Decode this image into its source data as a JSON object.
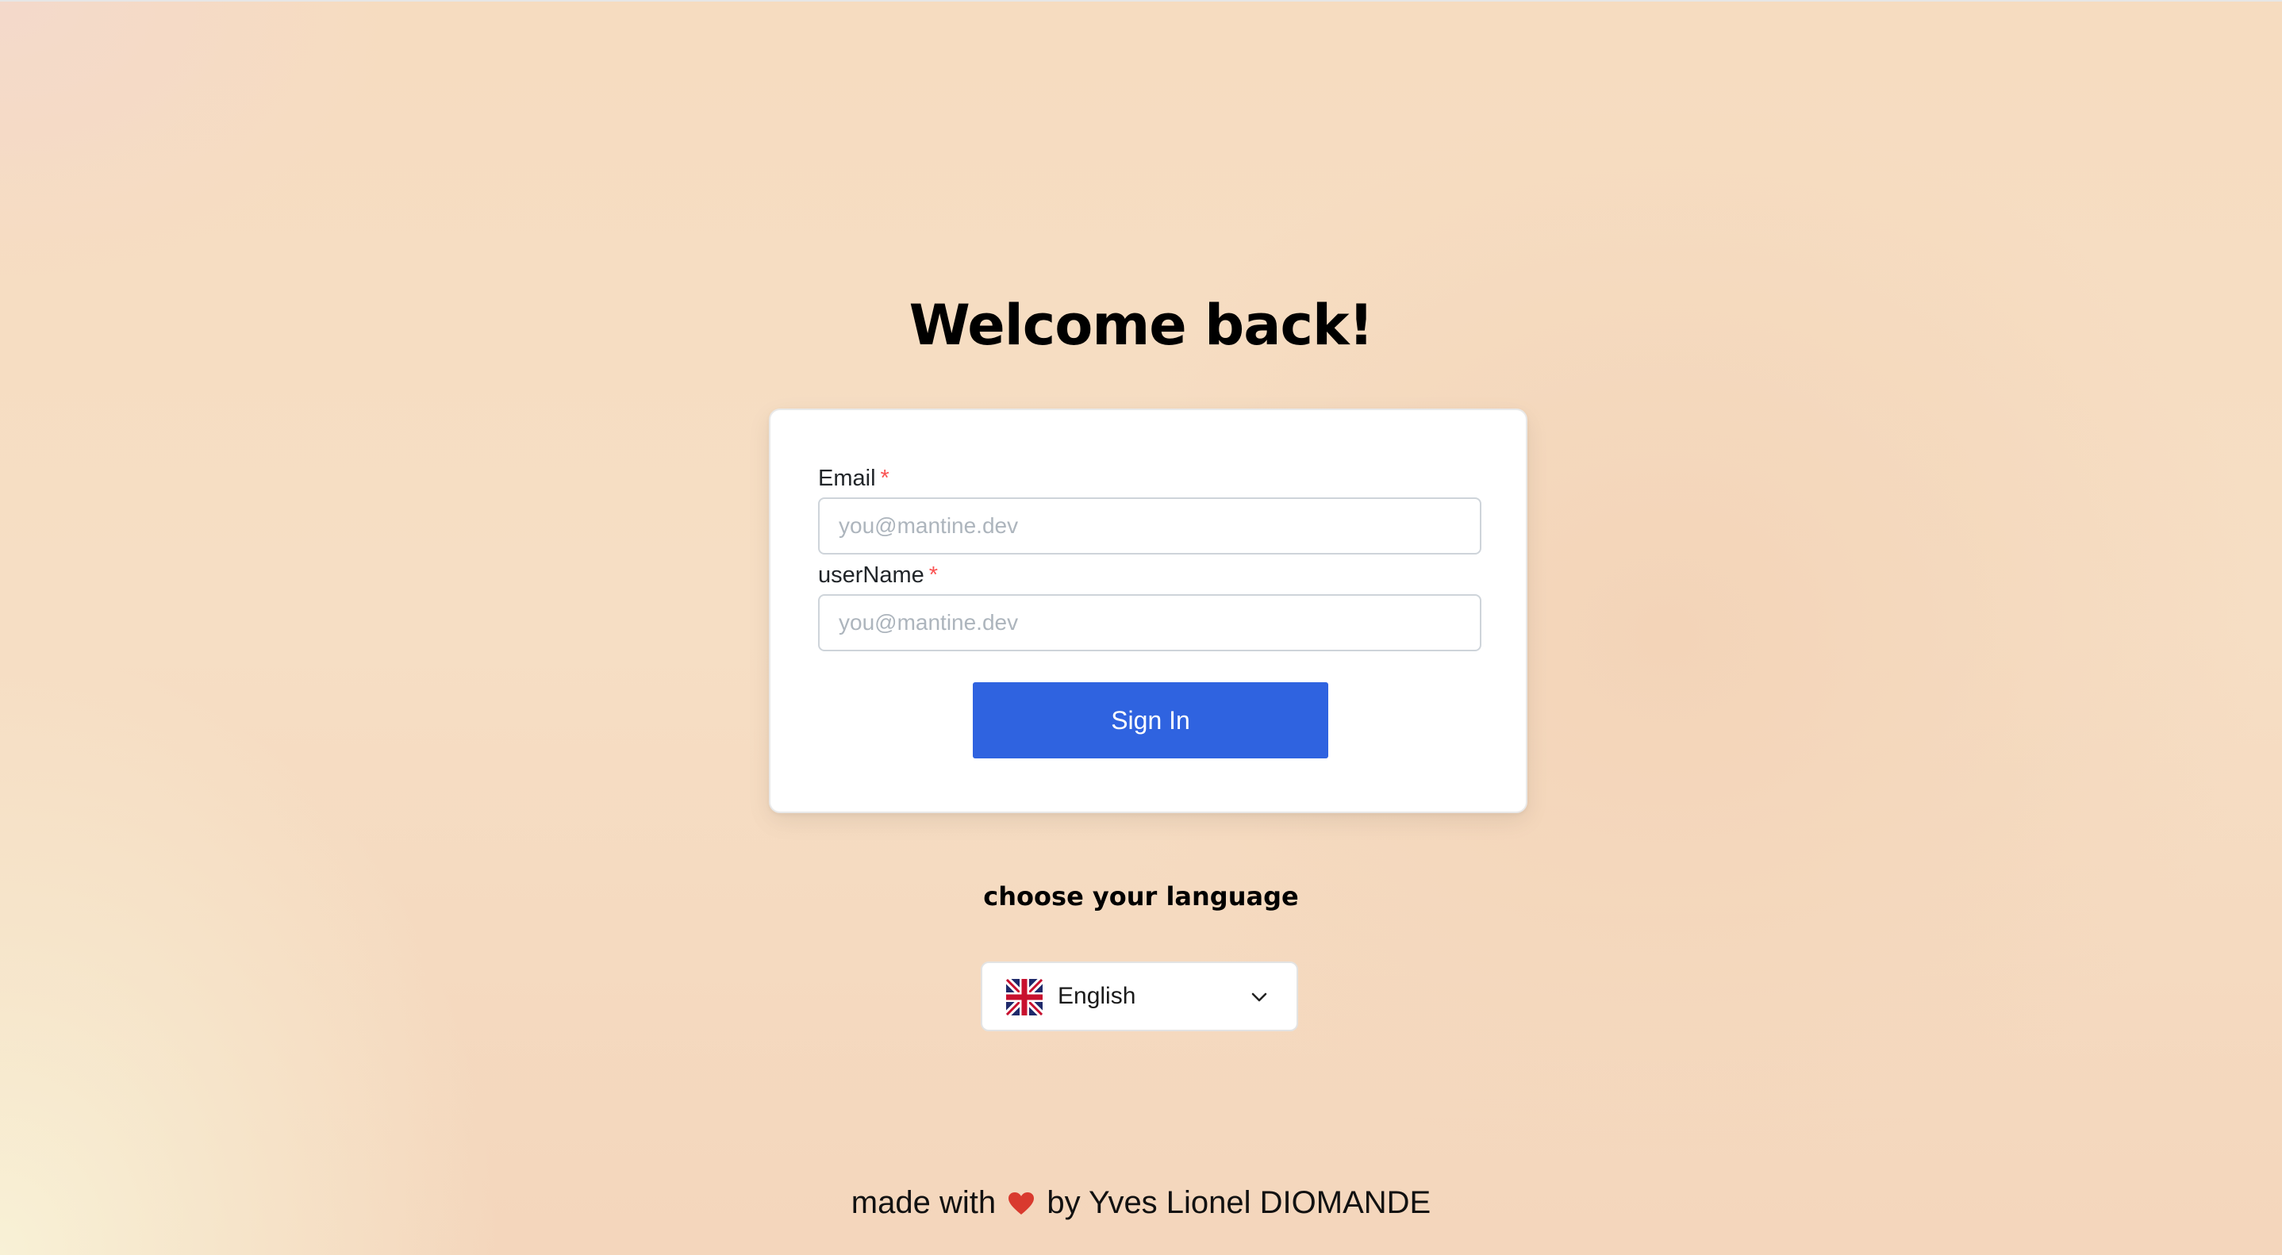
{
  "page": {
    "heading": "Welcome back!"
  },
  "form": {
    "email": {
      "label": "Email",
      "required_mark": "*",
      "placeholder": "you@mantine.dev",
      "value": ""
    },
    "username": {
      "label": "userName",
      "required_mark": "*",
      "placeholder": "you@mantine.dev",
      "value": ""
    },
    "submit_label": "Sign In"
  },
  "language": {
    "title": "choose your language",
    "selected": "English",
    "flag_icon": "uk-flag-icon",
    "chevron_icon": "chevron-down-icon"
  },
  "footer": {
    "prefix": "made with",
    "heart_icon": "heart-icon",
    "suffix": "by Yves Lionel DIOMANDE"
  },
  "colors": {
    "primary_button": "#2f63e0",
    "required_mark": "#fa5252",
    "heart": "#d93a2e"
  }
}
